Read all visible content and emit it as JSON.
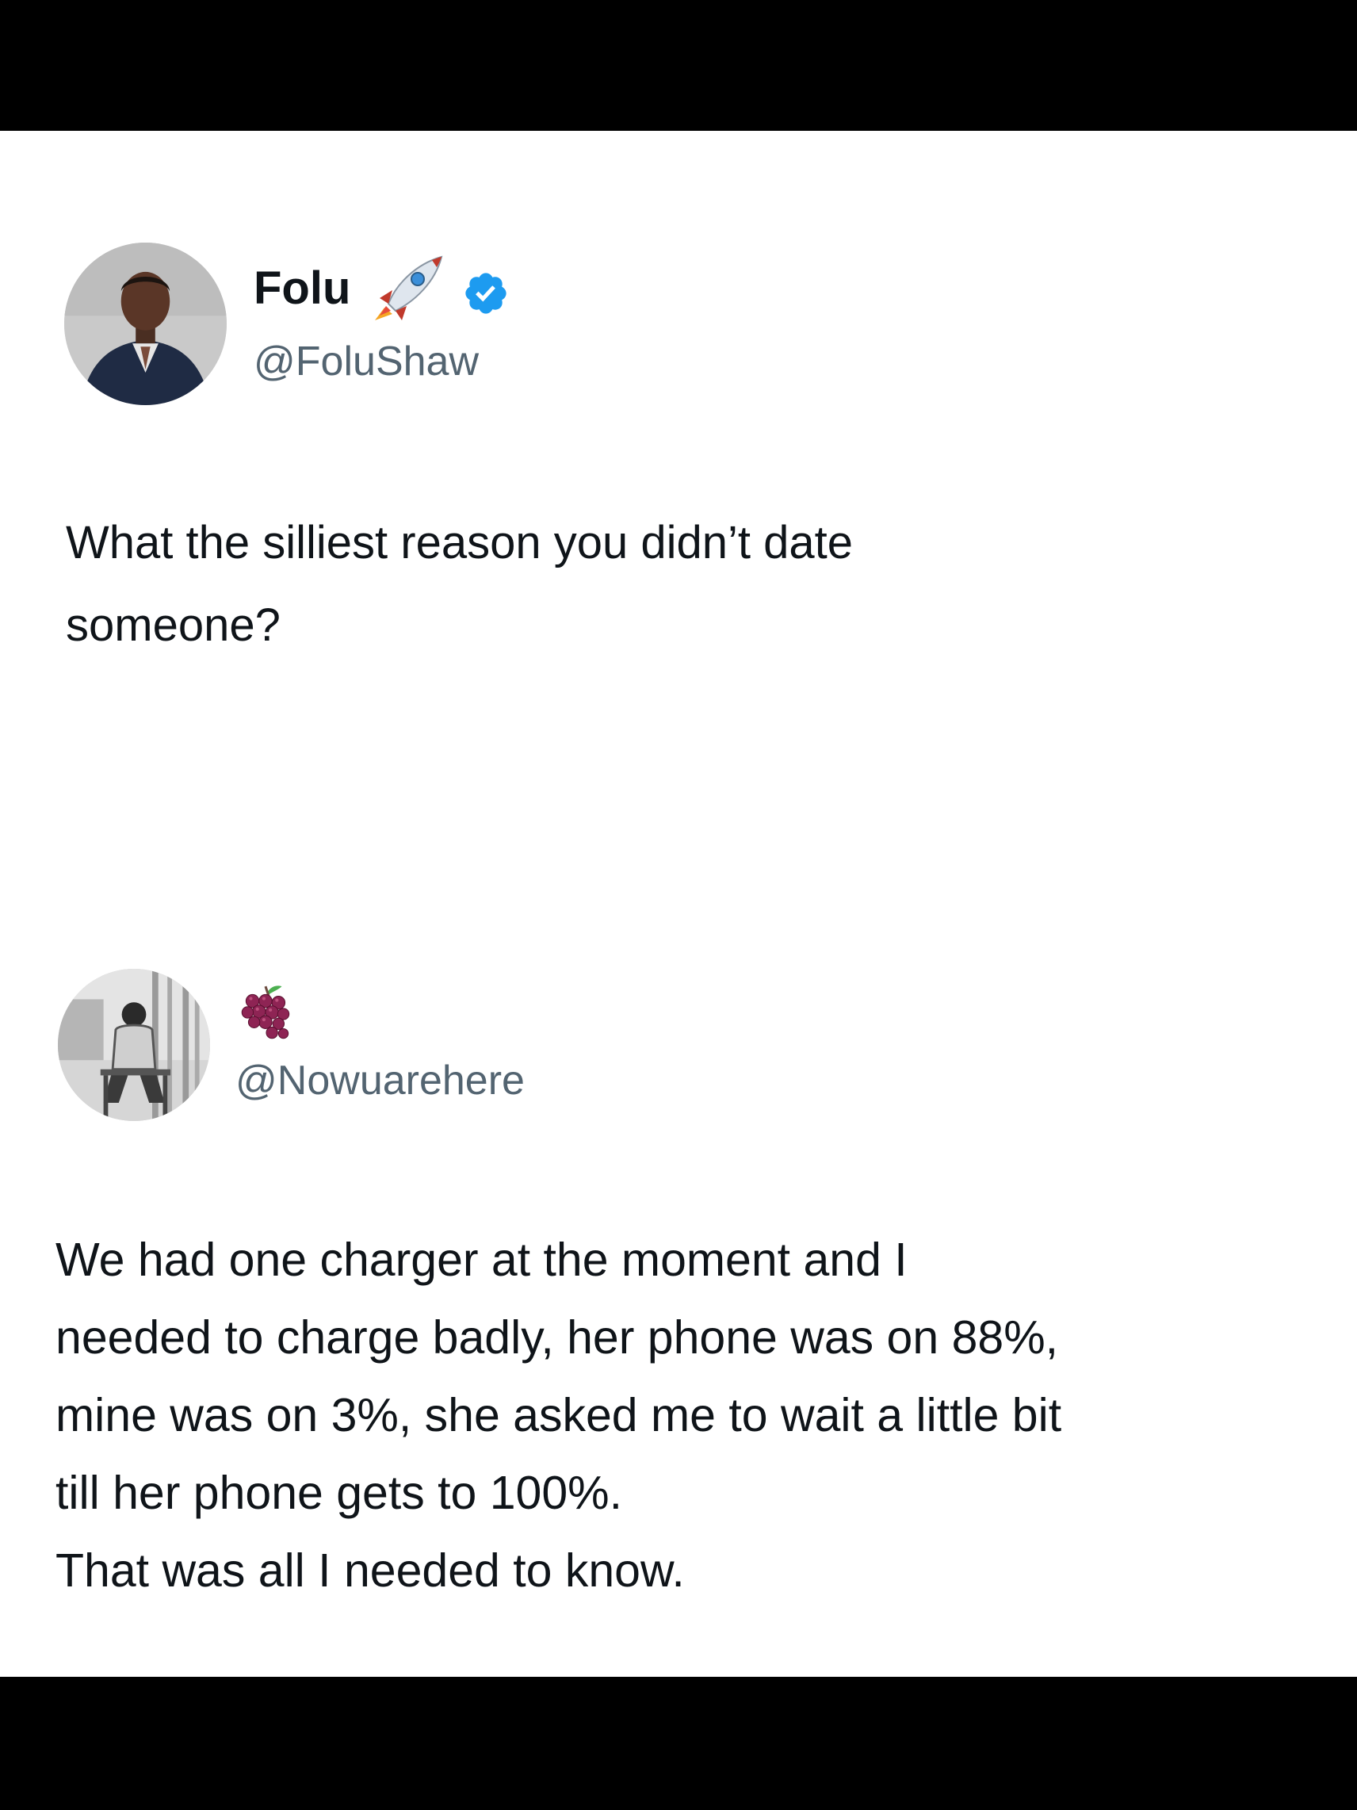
{
  "tweets": [
    {
      "display_name": "Folu",
      "handle": "@FoluShaw",
      "name_emoji": "rocket-icon",
      "verified": true,
      "verified_color": "#1d9bf0",
      "text": "What the silliest reason you didn’t date\nsomeone?"
    },
    {
      "display_name": "",
      "handle": "@Nowuarehere",
      "name_emoji": "grapes-icon",
      "verified": false,
      "text": "We had one charger at the moment and I\nneeded to charge badly, her phone was on 88%,\nmine was on 3%, she asked me to wait a little bit\ntill her phone gets to 100%.\nThat was all I needed to know."
    }
  ],
  "colors": {
    "background": "#ffffff",
    "frame": "#000000",
    "text_primary": "#0f1419",
    "text_secondary": "#536471"
  }
}
